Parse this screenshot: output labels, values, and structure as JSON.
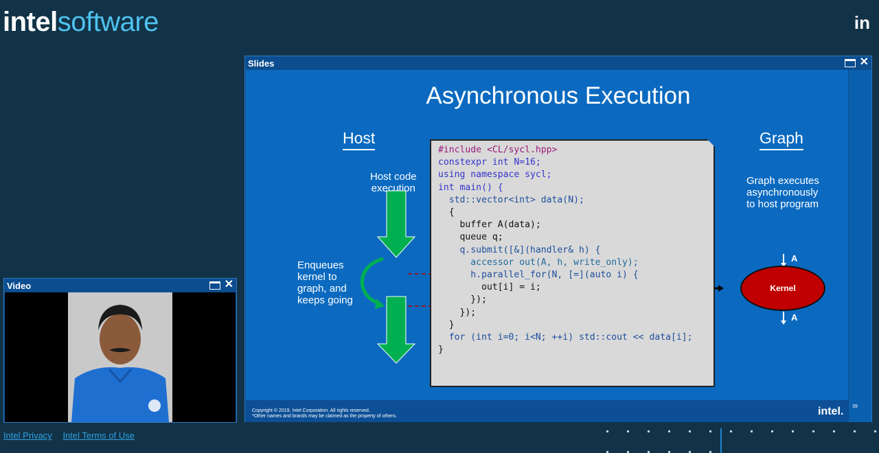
{
  "header": {
    "brand_part1": "intel",
    "brand_part2": "software",
    "linkedin_label": "in"
  },
  "slides_window": {
    "title": "Slides",
    "slide": {
      "title": "Asynchronous Execution",
      "host_heading": "Host",
      "graph_heading": "Graph",
      "host_code_label": [
        "Host code",
        "execution"
      ],
      "enqueue_label": [
        "Enqueues",
        "kernel to",
        "graph, and",
        "keeps going"
      ],
      "graph_label": [
        "Graph executes",
        "asynchronously",
        "to host program"
      ],
      "kernel_label": "Kernel",
      "buffer_label_top": "A",
      "buffer_label_bottom": "A",
      "code_lines": [
        "#include <CL/sycl.hpp>",
        "constexpr int N=16;",
        "using namespace sycl;",
        "int main() {",
        "  std::vector<int> data(N);",
        "  {",
        "    buffer A(data);",
        "    queue q;",
        "    q.submit([&](handler& h) {",
        "      accessor out(A, h, write_only);",
        "      h.parallel_for(N, [=](auto i) {",
        "        out[i] = i;",
        "      });",
        "    });",
        "  }",
        "  for (int i=0; i<N; ++i) std::cout << data[i];",
        "}"
      ],
      "copyright_line1": "Copyright © 2019, Intel Corporation. All rights reserved.",
      "copyright_line2": "*Other names and brands may be claimed as the property of others.",
      "footer_logo": "intel.",
      "page_number": "39"
    },
    "colors": {
      "slide_bg": "#0b6ac0",
      "arrow_green": "#00b050",
      "kernel_red": "#c00000"
    }
  },
  "video_window": {
    "title": "Video"
  },
  "footer_links": {
    "privacy": "Intel Privacy",
    "terms": "Intel Terms of Use"
  }
}
